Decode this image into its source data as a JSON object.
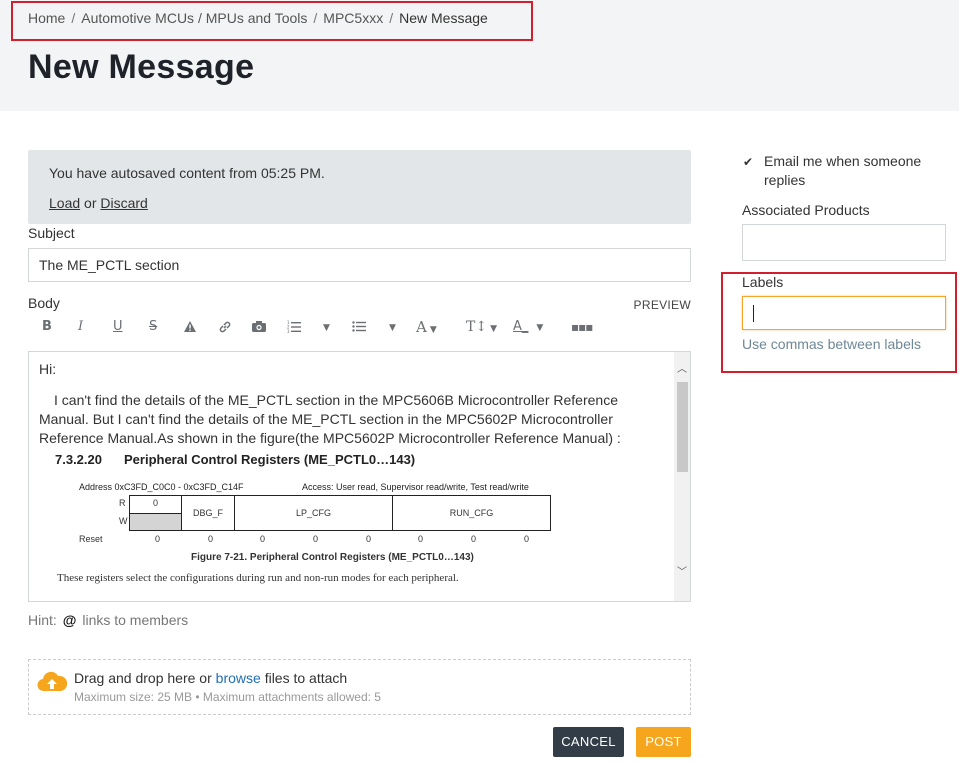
{
  "breadcrumb": {
    "items": [
      "Home",
      "Automotive MCUs / MPUs and Tools",
      "MPC5xxx"
    ],
    "current": "New Message",
    "separator": "/"
  },
  "page": {
    "title": "New Message"
  },
  "autosave": {
    "message": "You have autosaved content from 05:25 PM.",
    "load_label": "Load",
    "or_text": "or",
    "discard_label": "Discard"
  },
  "form": {
    "subject_label": "Subject",
    "subject_value": "The ME_PCTL section",
    "body_label": "Body",
    "preview_label": "PREVIEW"
  },
  "toolbar": {
    "icons": [
      "bold-icon",
      "italic-icon",
      "underline-icon",
      "strikethrough-icon",
      "spoiler-icon",
      "link-icon",
      "image-icon",
      "numbered-list-icon",
      "bulleted-list-icon",
      "font-color-icon",
      "font-size-icon",
      "text-format-icon",
      "more-icon"
    ]
  },
  "body": {
    "greeting": "Hi:",
    "paragraph": "I can't find the details of the ME_PCTL  section in the MPC5606B Microcontroller Reference Manual. But I can't find the details of the ME_PCTL  section in the MPC5602P Microcontroller Reference Manual.As shown in the figure(the MPC5602P Microcontroller Reference Manual) :",
    "figure": {
      "heading_num": "7.3.2.20",
      "heading_text": "Peripheral Control Registers (ME_PCTL0…143)",
      "address": "Address 0xC3FD_C0C0 - 0xC3FD_C14F",
      "access": "Access: User read, Supervisor read/write, Test read/write",
      "row_r": "R",
      "row_w": "W",
      "row_reset": "Reset",
      "r_value": "0",
      "fields": [
        "DBG_F",
        "LP_CFG",
        "RUN_CFG"
      ],
      "reset_values": [
        "0",
        "0",
        "0",
        "0",
        "0",
        "0",
        "0",
        "0"
      ],
      "caption": "Figure 7-21. Peripheral Control Registers (ME_PCTL0…143)",
      "description": "These registers select the configurations during run and non-run modes for each peripheral."
    }
  },
  "hint": {
    "prefix": "Hint:",
    "at": "@",
    "text": "links to members"
  },
  "attachments": {
    "drag_text": "Drag and drop here or",
    "browse_label": "browse",
    "suffix": "files to attach",
    "limits": "Maximum size: 25 MB • Maximum attachments allowed: 5"
  },
  "actions": {
    "cancel_label": "CANCEL",
    "post_label": "POST"
  },
  "sidebar": {
    "email_label": "Email me when someone replies",
    "email_checked": true,
    "associated_products_label": "Associated Products",
    "labels_label": "Labels",
    "labels_value": "",
    "labels_hint": "Use commas between labels"
  },
  "colors": {
    "highlight": "#d0202e",
    "post_button": "#f6a61c",
    "cancel_button": "#333d47",
    "link": "#1f6fb5",
    "focus_border": "#f2a62b"
  }
}
